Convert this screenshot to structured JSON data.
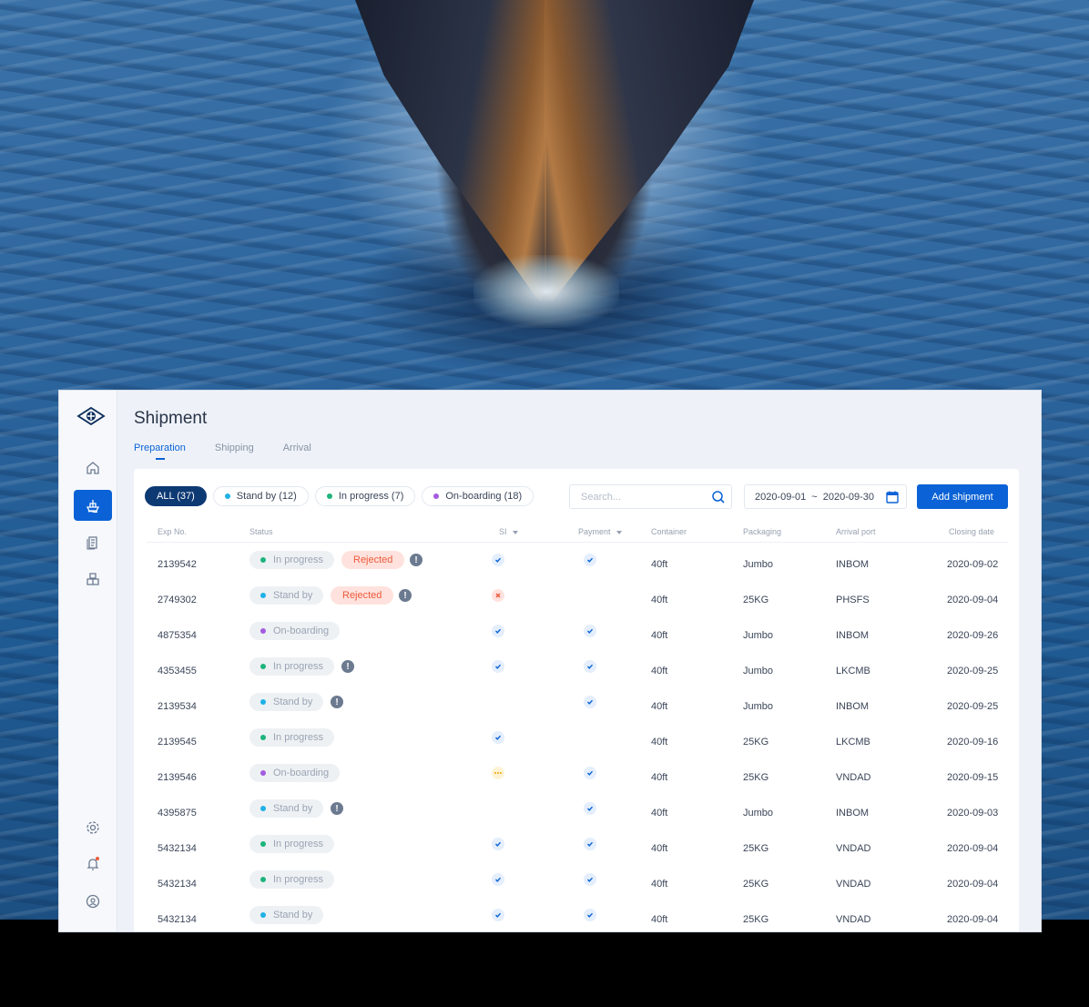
{
  "app": {
    "page_title": "Shipment",
    "tabs": [
      "Preparation",
      "Shipping",
      "Arrival"
    ],
    "active_tab": "Preparation"
  },
  "sidebar": {
    "items": [
      {
        "icon": "home-icon",
        "active": false
      },
      {
        "icon": "ship-icon",
        "active": true
      },
      {
        "icon": "documents-icon",
        "active": false
      },
      {
        "icon": "boxes-icon",
        "active": false
      },
      {
        "icon": "gear-icon",
        "active": false
      },
      {
        "icon": "bell-icon",
        "active": false
      },
      {
        "icon": "user-icon",
        "active": false
      }
    ]
  },
  "filters": {
    "all": "ALL (37)",
    "stand_by": "Stand by (12)",
    "in_progress": "In progress (7)",
    "on_boarding": "On-boarding (18)"
  },
  "search": {
    "placeholder": "Search..."
  },
  "date_range": {
    "from": "2020-09-01",
    "separator": "~",
    "to": "2020-09-30"
  },
  "add_button": "Add shipment",
  "colors": {
    "primary": "#0a62d6",
    "stand_by": "#1fb1e6",
    "in_progress": "#1db47c",
    "on_boarding": "#a35be0",
    "rejected": "#ec5a3c"
  },
  "table": {
    "columns": {
      "exp_no": "Exp No.",
      "status": "Status",
      "si": "SI",
      "payment": "Payment",
      "container": "Container",
      "packaging": "Packaging",
      "arrival_port": "Arrival port",
      "closing_date": "Closing date"
    },
    "rows": [
      {
        "exp_no": "2139542",
        "status": "In progress",
        "rejected": "Rejected",
        "info": "!",
        "si": "check",
        "payment": "check",
        "container": "40ft",
        "packaging": "Jumbo",
        "arrival_port": "INBOM",
        "closing_date": "2020-09-02"
      },
      {
        "exp_no": "2749302",
        "status": "Stand by",
        "rejected": "Rejected",
        "info": "!",
        "si": "x",
        "payment": "",
        "container": "40ft",
        "packaging": "25KG",
        "arrival_port": "PHSFS",
        "closing_date": "2020-09-04"
      },
      {
        "exp_no": "4875354",
        "status": "On-boarding",
        "rejected": "",
        "info": "",
        "si": "check",
        "payment": "check",
        "container": "40ft",
        "packaging": "Jumbo",
        "arrival_port": "INBOM",
        "closing_date": "2020-09-26"
      },
      {
        "exp_no": "4353455",
        "status": "In progress",
        "rejected": "",
        "info": "!",
        "si": "check",
        "payment": "check",
        "container": "40ft",
        "packaging": "Jumbo",
        "arrival_port": "LKCMB",
        "closing_date": "2020-09-25"
      },
      {
        "exp_no": "2139534",
        "status": "Stand by",
        "rejected": "",
        "info": "!",
        "si": "",
        "payment": "check",
        "container": "40ft",
        "packaging": "Jumbo",
        "arrival_port": "INBOM",
        "closing_date": "2020-09-25"
      },
      {
        "exp_no": "2139545",
        "status": "In progress",
        "rejected": "",
        "info": "",
        "si": "check",
        "payment": "",
        "container": "40ft",
        "packaging": "25KG",
        "arrival_port": "LKCMB",
        "closing_date": "2020-09-16"
      },
      {
        "exp_no": "2139546",
        "status": "On-boarding",
        "rejected": "",
        "info": "",
        "si": "pending",
        "payment": "check",
        "container": "40ft",
        "packaging": "25KG",
        "arrival_port": "VNDAD",
        "closing_date": "2020-09-15"
      },
      {
        "exp_no": "4395875",
        "status": "Stand by",
        "rejected": "",
        "info": "!",
        "si": "",
        "payment": "check",
        "container": "40ft",
        "packaging": "Jumbo",
        "arrival_port": "INBOM",
        "closing_date": "2020-09-03"
      },
      {
        "exp_no": "5432134",
        "status": "In progress",
        "rejected": "",
        "info": "",
        "si": "check",
        "payment": "check",
        "container": "40ft",
        "packaging": "25KG",
        "arrival_port": "VNDAD",
        "closing_date": "2020-09-04"
      },
      {
        "exp_no": "5432134",
        "status": "In progress",
        "rejected": "",
        "info": "",
        "si": "check",
        "payment": "check",
        "container": "40ft",
        "packaging": "25KG",
        "arrival_port": "VNDAD",
        "closing_date": "2020-09-04"
      },
      {
        "exp_no": "5432134",
        "status": "Stand by",
        "rejected": "",
        "info": "",
        "si": "check",
        "payment": "check",
        "container": "40ft",
        "packaging": "25KG",
        "arrival_port": "VNDAD",
        "closing_date": "2020-09-04"
      }
    ]
  }
}
